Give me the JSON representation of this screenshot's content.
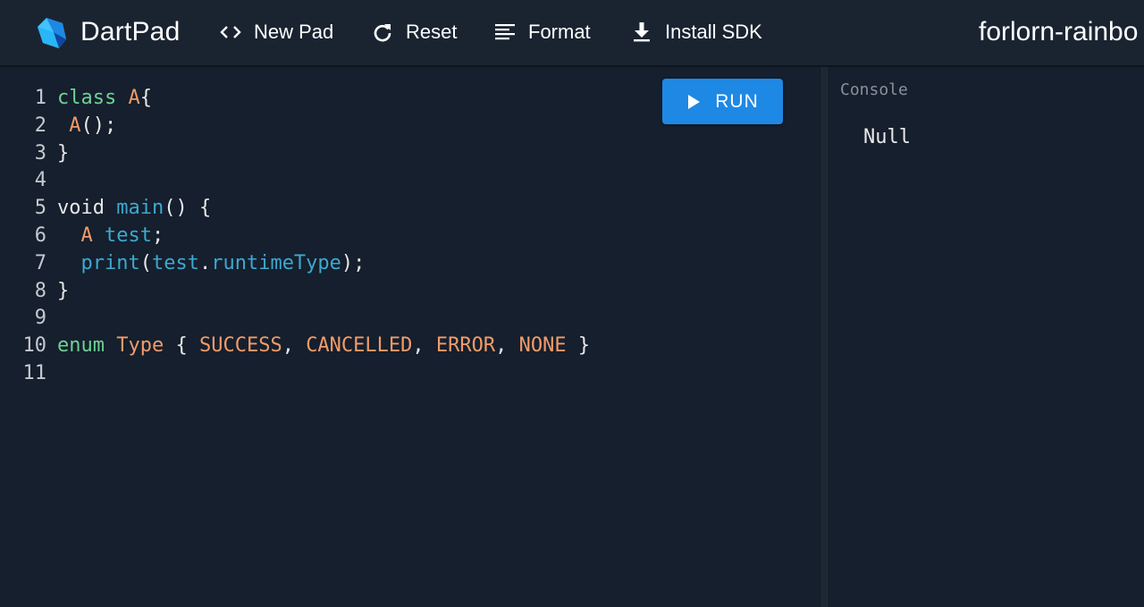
{
  "app": {
    "brand": "DartPad",
    "logo_icon": "dart-logo-icon",
    "pad_name": "forlorn-rainbo"
  },
  "toolbar": {
    "new_pad": {
      "label": "New Pad",
      "icon": "code-brackets-icon"
    },
    "reset": {
      "label": "Reset",
      "icon": "refresh-icon"
    },
    "format": {
      "label": "Format",
      "icon": "align-left-icon"
    },
    "install": {
      "label": "Install SDK",
      "icon": "download-icon"
    }
  },
  "editor": {
    "run_label": "RUN",
    "run_icon": "play-icon",
    "lines": [
      {
        "n": "1",
        "tokens": [
          [
            "kw",
            "class"
          ],
          [
            "pl",
            " "
          ],
          [
            "ty",
            "A"
          ],
          [
            "pl",
            "{"
          ]
        ]
      },
      {
        "n": "2",
        "tokens": [
          [
            "pl",
            " "
          ],
          [
            "ty",
            "A"
          ],
          [
            "pl",
            "();"
          ]
        ]
      },
      {
        "n": "3",
        "tokens": [
          [
            "pl",
            "}"
          ]
        ]
      },
      {
        "n": "4",
        "tokens": []
      },
      {
        "n": "5",
        "tokens": [
          [
            "pl",
            "void "
          ],
          [
            "fn",
            "main"
          ],
          [
            "pl",
            "() {"
          ]
        ]
      },
      {
        "n": "6",
        "tokens": [
          [
            "pl",
            "  "
          ],
          [
            "ty",
            "A"
          ],
          [
            "pl",
            " "
          ],
          [
            "fn",
            "test"
          ],
          [
            "pl",
            ";"
          ]
        ]
      },
      {
        "n": "7",
        "tokens": [
          [
            "pl",
            "  "
          ],
          [
            "fn",
            "print"
          ],
          [
            "pl",
            "("
          ],
          [
            "fn",
            "test"
          ],
          [
            "pl",
            "."
          ],
          [
            "fn",
            "runtimeType"
          ],
          [
            "pl",
            ");"
          ]
        ]
      },
      {
        "n": "8",
        "tokens": [
          [
            "pl",
            "}"
          ]
        ]
      },
      {
        "n": "9",
        "tokens": []
      },
      {
        "n": "10",
        "tokens": [
          [
            "kw",
            "enum"
          ],
          [
            "pl",
            " "
          ],
          [
            "ty",
            "Type"
          ],
          [
            "pl",
            " { "
          ],
          [
            "ty",
            "SUCCESS"
          ],
          [
            "pl",
            ", "
          ],
          [
            "ty",
            "CANCELLED"
          ],
          [
            "pl",
            ", "
          ],
          [
            "ty",
            "ERROR"
          ],
          [
            "pl",
            ", "
          ],
          [
            "ty",
            "NONE"
          ],
          [
            "pl",
            " }"
          ]
        ]
      },
      {
        "n": "11",
        "tokens": []
      }
    ]
  },
  "console": {
    "title": "Console",
    "output": "Null"
  },
  "colors": {
    "background": "#151f2d",
    "toolbar": "#1a2431",
    "run_button": "#1e88e5",
    "keyword": "#6fd194",
    "type": "#f39b6a",
    "function": "#3ea8cf"
  }
}
